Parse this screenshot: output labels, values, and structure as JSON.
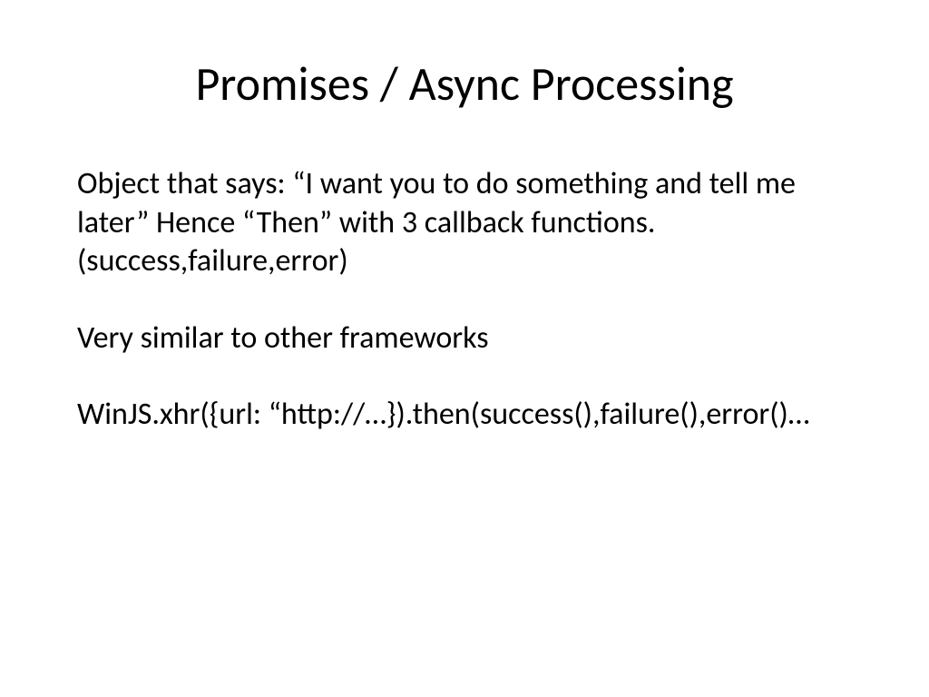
{
  "slide": {
    "title": "Promises / Async Processing",
    "paragraph1": "Object that says:  “I want you to do something and tell me later”   Hence “Then” with 3 callback functions. (success,failure,error)",
    "paragraph2": "Very similar to other frameworks",
    "paragraph3": "WinJS.xhr({url: “http://…}).then(success(),failure(),error()…"
  }
}
